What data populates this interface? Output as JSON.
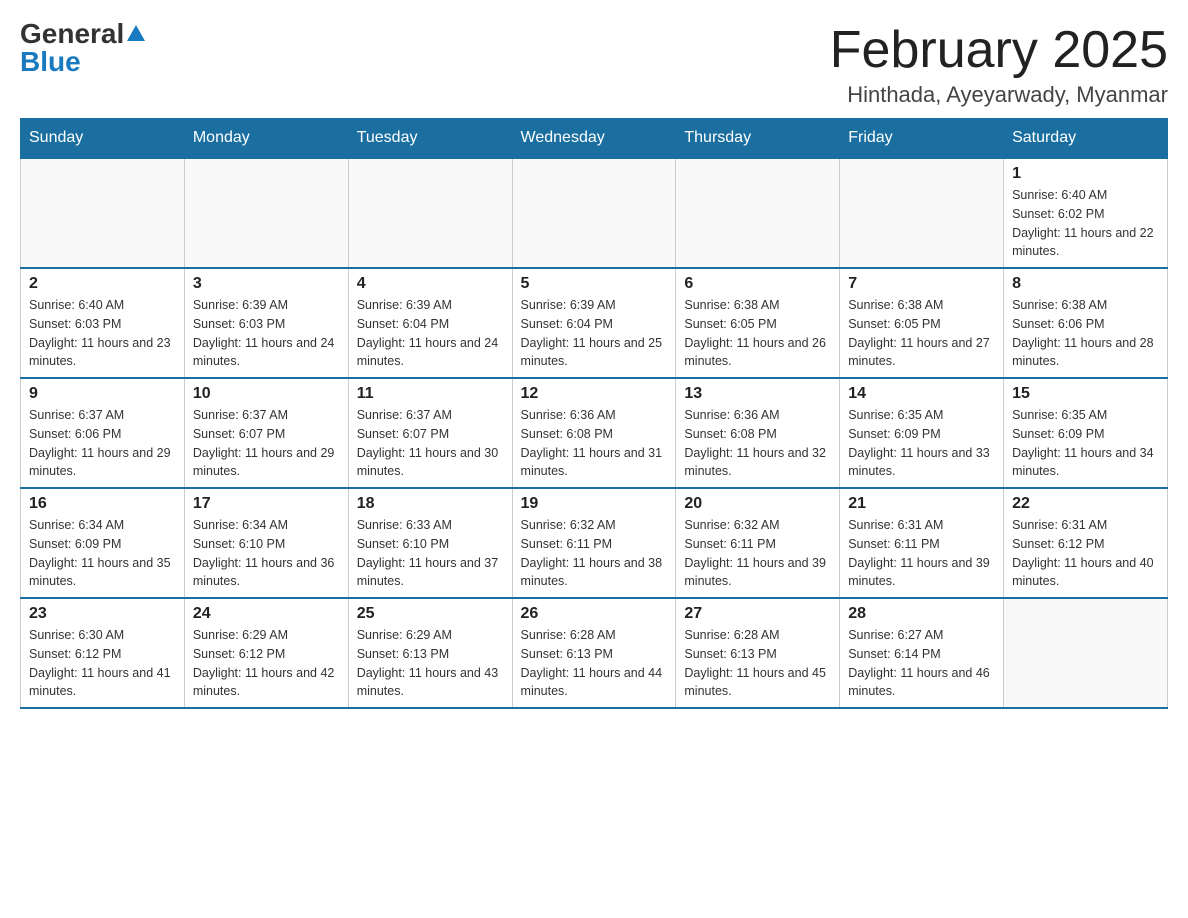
{
  "logo": {
    "general": "General",
    "blue": "Blue"
  },
  "header": {
    "month_year": "February 2025",
    "location": "Hinthada, Ayeyarwady, Myanmar"
  },
  "weekdays": [
    "Sunday",
    "Monday",
    "Tuesday",
    "Wednesday",
    "Thursday",
    "Friday",
    "Saturday"
  ],
  "weeks": [
    [
      {
        "day": "",
        "sunrise": "",
        "sunset": "",
        "daylight": ""
      },
      {
        "day": "",
        "sunrise": "",
        "sunset": "",
        "daylight": ""
      },
      {
        "day": "",
        "sunrise": "",
        "sunset": "",
        "daylight": ""
      },
      {
        "day": "",
        "sunrise": "",
        "sunset": "",
        "daylight": ""
      },
      {
        "day": "",
        "sunrise": "",
        "sunset": "",
        "daylight": ""
      },
      {
        "day": "",
        "sunrise": "",
        "sunset": "",
        "daylight": ""
      },
      {
        "day": "1",
        "sunrise": "Sunrise: 6:40 AM",
        "sunset": "Sunset: 6:02 PM",
        "daylight": "Daylight: 11 hours and 22 minutes."
      }
    ],
    [
      {
        "day": "2",
        "sunrise": "Sunrise: 6:40 AM",
        "sunset": "Sunset: 6:03 PM",
        "daylight": "Daylight: 11 hours and 23 minutes."
      },
      {
        "day": "3",
        "sunrise": "Sunrise: 6:39 AM",
        "sunset": "Sunset: 6:03 PM",
        "daylight": "Daylight: 11 hours and 24 minutes."
      },
      {
        "day": "4",
        "sunrise": "Sunrise: 6:39 AM",
        "sunset": "Sunset: 6:04 PM",
        "daylight": "Daylight: 11 hours and 24 minutes."
      },
      {
        "day": "5",
        "sunrise": "Sunrise: 6:39 AM",
        "sunset": "Sunset: 6:04 PM",
        "daylight": "Daylight: 11 hours and 25 minutes."
      },
      {
        "day": "6",
        "sunrise": "Sunrise: 6:38 AM",
        "sunset": "Sunset: 6:05 PM",
        "daylight": "Daylight: 11 hours and 26 minutes."
      },
      {
        "day": "7",
        "sunrise": "Sunrise: 6:38 AM",
        "sunset": "Sunset: 6:05 PM",
        "daylight": "Daylight: 11 hours and 27 minutes."
      },
      {
        "day": "8",
        "sunrise": "Sunrise: 6:38 AM",
        "sunset": "Sunset: 6:06 PM",
        "daylight": "Daylight: 11 hours and 28 minutes."
      }
    ],
    [
      {
        "day": "9",
        "sunrise": "Sunrise: 6:37 AM",
        "sunset": "Sunset: 6:06 PM",
        "daylight": "Daylight: 11 hours and 29 minutes."
      },
      {
        "day": "10",
        "sunrise": "Sunrise: 6:37 AM",
        "sunset": "Sunset: 6:07 PM",
        "daylight": "Daylight: 11 hours and 29 minutes."
      },
      {
        "day": "11",
        "sunrise": "Sunrise: 6:37 AM",
        "sunset": "Sunset: 6:07 PM",
        "daylight": "Daylight: 11 hours and 30 minutes."
      },
      {
        "day": "12",
        "sunrise": "Sunrise: 6:36 AM",
        "sunset": "Sunset: 6:08 PM",
        "daylight": "Daylight: 11 hours and 31 minutes."
      },
      {
        "day": "13",
        "sunrise": "Sunrise: 6:36 AM",
        "sunset": "Sunset: 6:08 PM",
        "daylight": "Daylight: 11 hours and 32 minutes."
      },
      {
        "day": "14",
        "sunrise": "Sunrise: 6:35 AM",
        "sunset": "Sunset: 6:09 PM",
        "daylight": "Daylight: 11 hours and 33 minutes."
      },
      {
        "day": "15",
        "sunrise": "Sunrise: 6:35 AM",
        "sunset": "Sunset: 6:09 PM",
        "daylight": "Daylight: 11 hours and 34 minutes."
      }
    ],
    [
      {
        "day": "16",
        "sunrise": "Sunrise: 6:34 AM",
        "sunset": "Sunset: 6:09 PM",
        "daylight": "Daylight: 11 hours and 35 minutes."
      },
      {
        "day": "17",
        "sunrise": "Sunrise: 6:34 AM",
        "sunset": "Sunset: 6:10 PM",
        "daylight": "Daylight: 11 hours and 36 minutes."
      },
      {
        "day": "18",
        "sunrise": "Sunrise: 6:33 AM",
        "sunset": "Sunset: 6:10 PM",
        "daylight": "Daylight: 11 hours and 37 minutes."
      },
      {
        "day": "19",
        "sunrise": "Sunrise: 6:32 AM",
        "sunset": "Sunset: 6:11 PM",
        "daylight": "Daylight: 11 hours and 38 minutes."
      },
      {
        "day": "20",
        "sunrise": "Sunrise: 6:32 AM",
        "sunset": "Sunset: 6:11 PM",
        "daylight": "Daylight: 11 hours and 39 minutes."
      },
      {
        "day": "21",
        "sunrise": "Sunrise: 6:31 AM",
        "sunset": "Sunset: 6:11 PM",
        "daylight": "Daylight: 11 hours and 39 minutes."
      },
      {
        "day": "22",
        "sunrise": "Sunrise: 6:31 AM",
        "sunset": "Sunset: 6:12 PM",
        "daylight": "Daylight: 11 hours and 40 minutes."
      }
    ],
    [
      {
        "day": "23",
        "sunrise": "Sunrise: 6:30 AM",
        "sunset": "Sunset: 6:12 PM",
        "daylight": "Daylight: 11 hours and 41 minutes."
      },
      {
        "day": "24",
        "sunrise": "Sunrise: 6:29 AM",
        "sunset": "Sunset: 6:12 PM",
        "daylight": "Daylight: 11 hours and 42 minutes."
      },
      {
        "day": "25",
        "sunrise": "Sunrise: 6:29 AM",
        "sunset": "Sunset: 6:13 PM",
        "daylight": "Daylight: 11 hours and 43 minutes."
      },
      {
        "day": "26",
        "sunrise": "Sunrise: 6:28 AM",
        "sunset": "Sunset: 6:13 PM",
        "daylight": "Daylight: 11 hours and 44 minutes."
      },
      {
        "day": "27",
        "sunrise": "Sunrise: 6:28 AM",
        "sunset": "Sunset: 6:13 PM",
        "daylight": "Daylight: 11 hours and 45 minutes."
      },
      {
        "day": "28",
        "sunrise": "Sunrise: 6:27 AM",
        "sunset": "Sunset: 6:14 PM",
        "daylight": "Daylight: 11 hours and 46 minutes."
      },
      {
        "day": "",
        "sunrise": "",
        "sunset": "",
        "daylight": ""
      }
    ]
  ]
}
